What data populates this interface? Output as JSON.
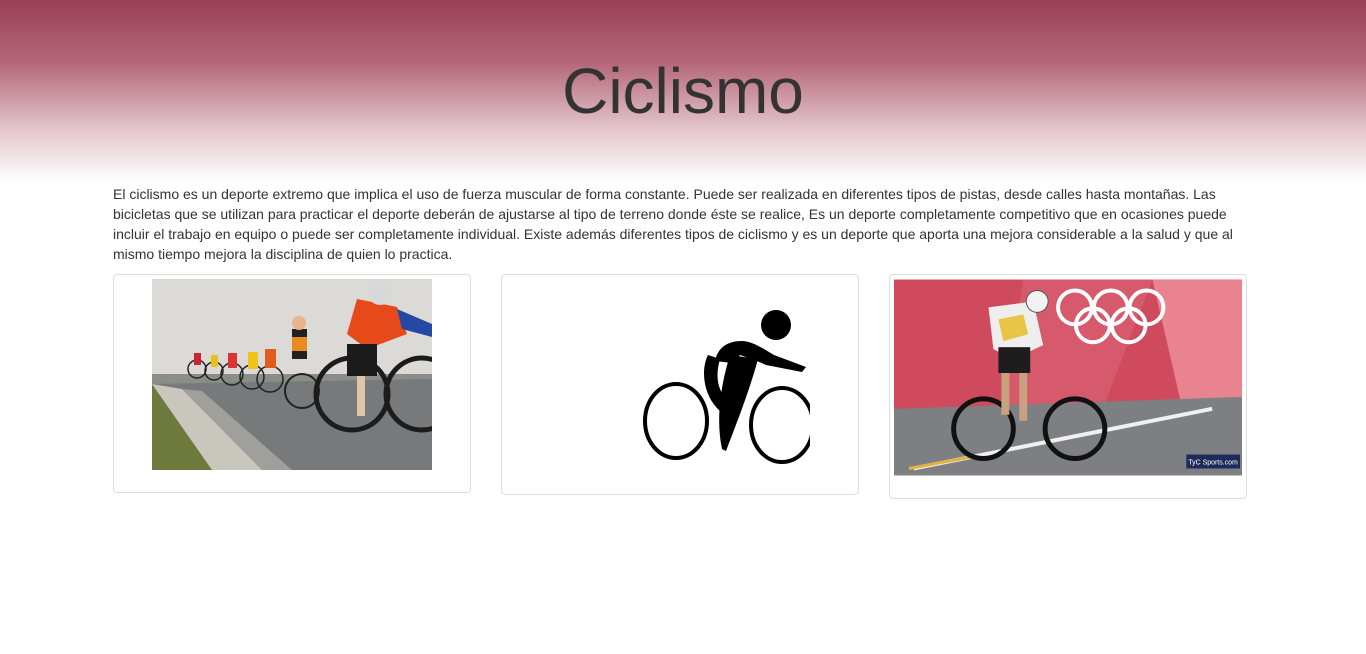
{
  "page": {
    "title": "Ciclismo",
    "intro": "El ciclismo es un deporte extremo que implica el uso de fuerza muscular de forma constante. Puede ser realizada en diferentes tipos de pistas, desde calles hasta montañas. Las bicicletas que se utilizan para practicar el deporte deberán de ajustarse al tipo de terreno donde éste se realice, Es un deporte completamente competitivo que en ocasiones puede incluir el trabajo en equipo o puede ser completamente individual. Existe además diferentes tipos de ciclismo y es un deporte que aporta una mejora considerable a la salud y que al mismo tiempo mejora la disciplina de quien lo practica."
  },
  "gallery": {
    "watermark": "TyC Sports.com"
  },
  "colors": {
    "header_top": "#9b3f56",
    "header_bottom": "#ffffff",
    "olympic_wall": "#cf4a5c"
  }
}
